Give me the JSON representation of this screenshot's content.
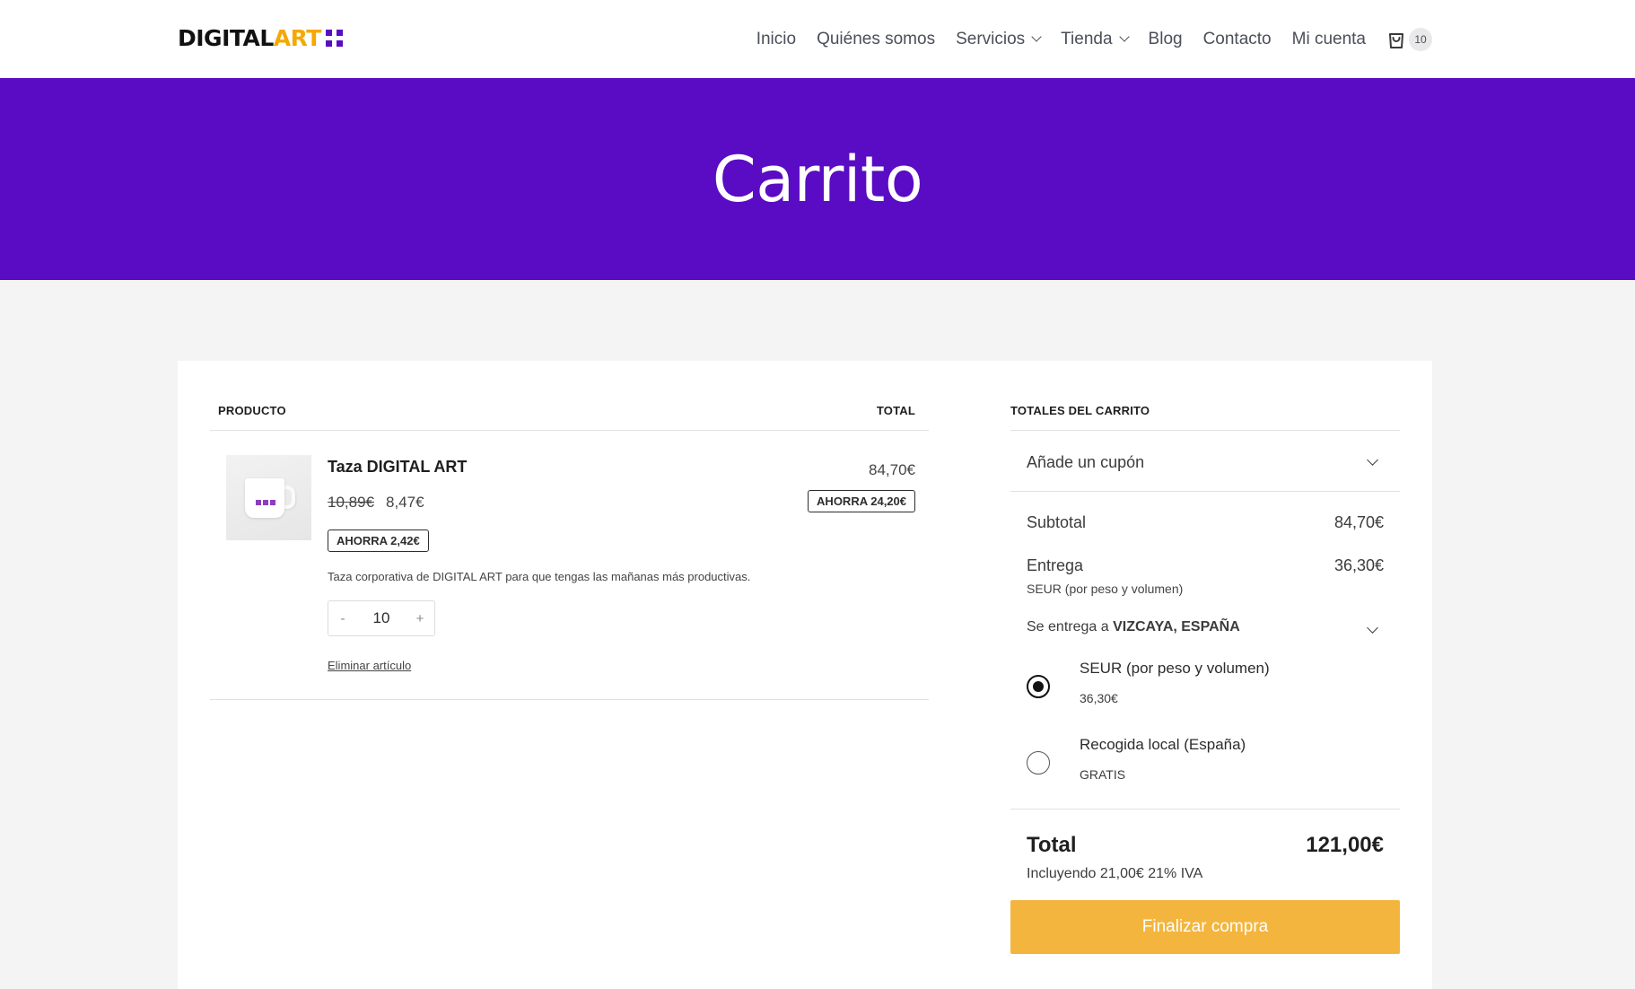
{
  "header": {
    "logo": {
      "part1": "DIGITAL",
      "part2": "ART"
    },
    "nav": [
      "Inicio",
      "Quiénes somos",
      "Servicios",
      "Tienda",
      "Blog",
      "Contacto",
      "Mi cuenta"
    ],
    "cart_count": "10"
  },
  "hero": {
    "title": "Carrito"
  },
  "cart": {
    "col_product": "PRODUCTO",
    "col_total": "TOTAL",
    "item": {
      "name": "Taza DIGITAL ART",
      "old_price": "10,89€",
      "price": "8,47€",
      "save_unit": "AHORRA 2,42€",
      "description": "Taza corporativa de DIGITAL ART para que tengas las mañanas más productivas.",
      "qty_minus": "-",
      "quantity": "10",
      "qty_plus": "+",
      "remove": "Eliminar artículo",
      "line_total": "84,70€",
      "save_total": "AHORRA 24,20€"
    }
  },
  "totals": {
    "heading": "TOTALES DEL CARRITO",
    "coupon": "Añade un cupón",
    "subtotal_label": "Subtotal",
    "subtotal_value": "84,70€",
    "delivery_label": "Entrega",
    "delivery_value": "36,30€",
    "delivery_method": "SEUR (por peso y volumen)",
    "ship_to_prefix": "Se entrega a ",
    "ship_to_place": "VIZCAYA, ESPAÑA",
    "options": [
      {
        "name": "SEUR (por peso y volumen)",
        "price": "36,30€",
        "selected": true
      },
      {
        "name": "Recogida local (España)",
        "price": "GRATIS",
        "selected": false
      }
    ],
    "total_label": "Total",
    "total_value": "121,00€",
    "tax_note": "Incluyendo 21,00€ 21% IVA",
    "checkout": "Finalizar compra"
  },
  "colors": {
    "brand_purple": "#5a0bc4",
    "logo_accent": "#f5a800",
    "checkout_button": "#f4b53e"
  }
}
